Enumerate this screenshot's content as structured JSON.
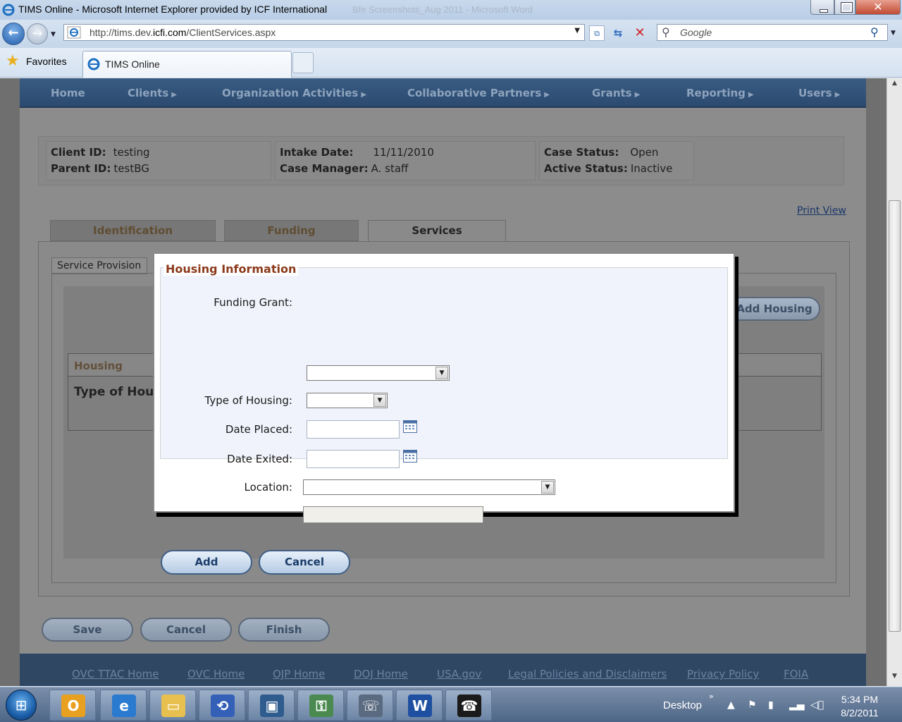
{
  "window": {
    "title": "TIMS Online - Microsoft Internet Explorer provided by ICF International",
    "ghost_title": "Bfe Screenshots_Aug 2011 - Microsoft Word"
  },
  "browser": {
    "url_prefix": "http://tims.dev.",
    "url_domain": "icfi.com",
    "url_suffix": "/ClientServices.aspx",
    "search_placeholder": "Google",
    "favorites_label": "Favorites",
    "tab_title": "TIMS Online"
  },
  "nav": {
    "items": [
      {
        "label": "Home",
        "arrow": ""
      },
      {
        "label": "Clients",
        "arrow": "▶"
      },
      {
        "label": "Organization Activities",
        "arrow": "▶"
      },
      {
        "label": "Collaborative Partners",
        "arrow": "▶"
      },
      {
        "label": "Grants",
        "arrow": "▶"
      },
      {
        "label": "Reporting",
        "arrow": "▶"
      },
      {
        "label": "Users",
        "arrow": "▶"
      }
    ]
  },
  "client_info": {
    "client_id_label": "Client ID:",
    "client_id": "testing",
    "parent_id_label": "Parent ID:",
    "parent_id": "testBG",
    "intake_date_label": "Intake Date:",
    "intake_date": "11/11/2010",
    "case_manager_label": "Case Manager:",
    "case_manager": "A. staff",
    "case_status_label": "Case Status:",
    "case_status": "Open",
    "active_status_label": "Active Status:",
    "active_status": "Inactive"
  },
  "print_view": "Print View",
  "tabs": [
    "Identification",
    "Funding",
    "Services"
  ],
  "subtab": "Service Provision",
  "add_housing": "Add Housing",
  "housing_table": {
    "header": "Housing",
    "row_label": "Type of Hou"
  },
  "page_buttons": {
    "save": "Save",
    "cancel": "Cancel",
    "finish": "Finish"
  },
  "footer_links": [
    "OVC TTAC Home",
    "OVC Home",
    "OJP Home",
    "DOJ Home",
    "USA.gov",
    "Legal Policies and Disclaimers",
    "Privacy Policy",
    "FOIA"
  ],
  "modal": {
    "legend": "Housing Information",
    "funding_grant_label": "Funding Grant:",
    "type_of_housing_label": "Type of Housing:",
    "date_placed_label": "Date Placed:",
    "date_exited_label": "Date Exited:",
    "location_label": "Location:",
    "funding_grant_value": "",
    "type_of_housing_value": "",
    "date_placed_value": "",
    "date_exited_value": "",
    "location_value": "",
    "add_button": "Add",
    "cancel_button": "Cancel"
  },
  "taskbar": {
    "desktop_label": "Desktop",
    "time": "5:34 PM",
    "date": "8/2/2011"
  }
}
